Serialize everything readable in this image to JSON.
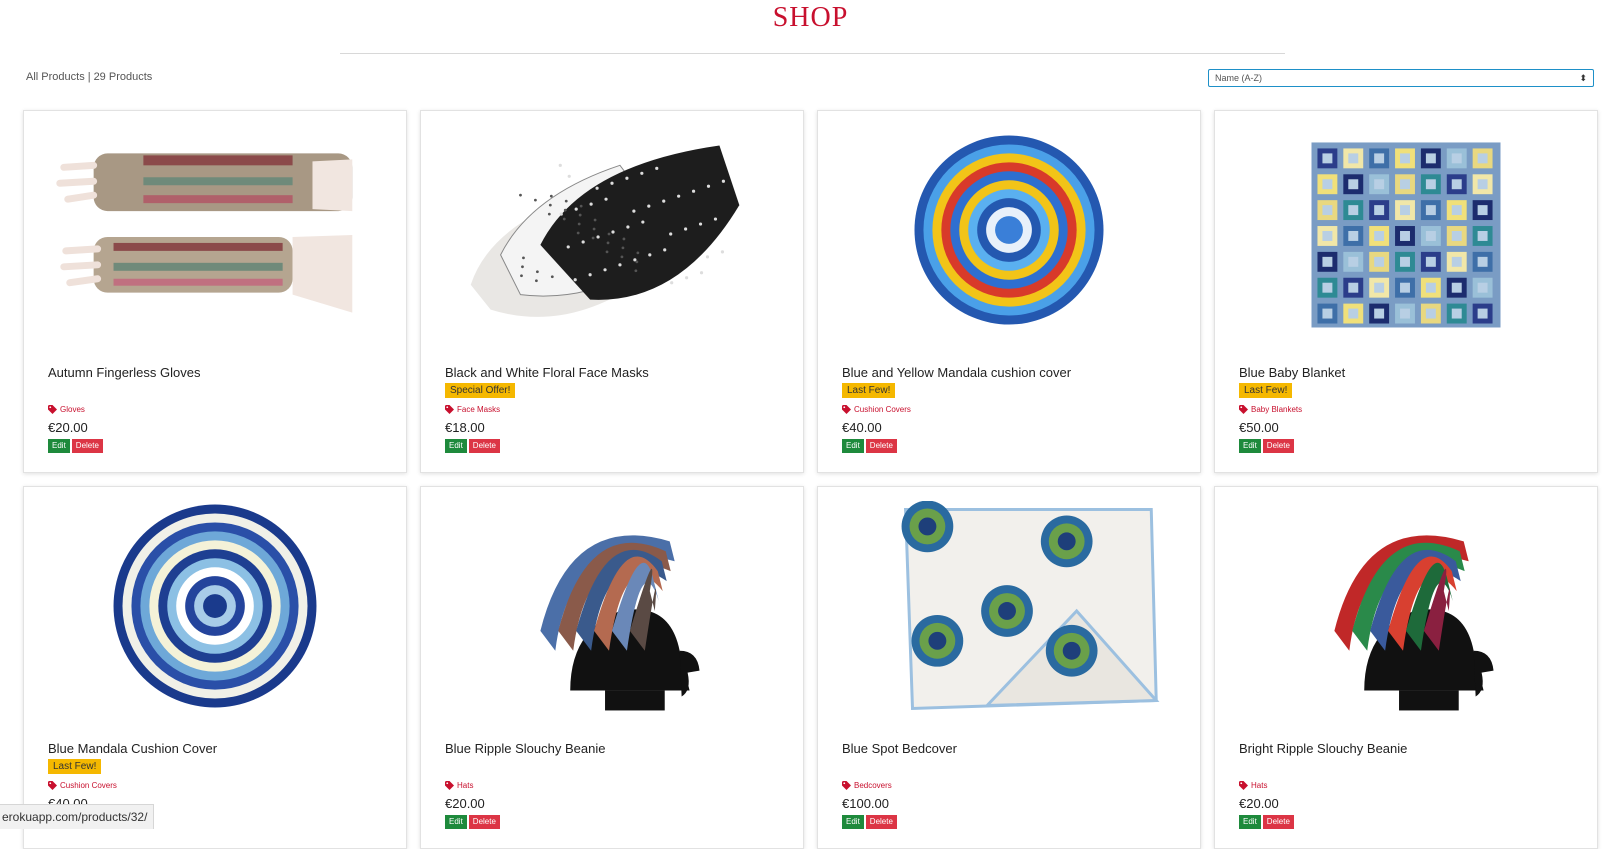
{
  "page": {
    "title": "SHOP"
  },
  "filter": {
    "category": "All Products",
    "count": "29 Products"
  },
  "sort": {
    "selected": "Name (A-Z)"
  },
  "products": [
    {
      "name": "Autumn Fingerless Gloves",
      "badge": "",
      "category": "Gloves",
      "price": "€20.00",
      "edit": "Edit",
      "delete": "Delete",
      "image": "gloves"
    },
    {
      "name": "Black and White Floral Face Masks",
      "badge": "Special Offer!",
      "category": "Face Masks",
      "price": "€18.00",
      "edit": "Edit",
      "delete": "Delete",
      "image": "masks"
    },
    {
      "name": "Blue and Yellow Mandala cushion cover",
      "badge": "Last Few!",
      "category": "Cushion Covers",
      "price": "€40.00",
      "edit": "Edit",
      "delete": "Delete",
      "image": "mandala-bright"
    },
    {
      "name": "Blue Baby Blanket",
      "badge": "Last Few!",
      "category": "Baby Blankets",
      "price": "€50.00",
      "edit": "Edit",
      "delete": "Delete",
      "image": "blanket"
    },
    {
      "name": "Blue Mandala Cushion Cover",
      "badge": "Last Few!",
      "category": "Cushion Covers",
      "price": "€40.00",
      "edit": "Edit",
      "delete": "Delete",
      "image": "mandala-blue"
    },
    {
      "name": "Blue Ripple Slouchy Beanie",
      "badge": "",
      "category": "Hats",
      "price": "€20.00",
      "edit": "Edit",
      "delete": "Delete",
      "image": "beanie-blue"
    },
    {
      "name": "Blue Spot Bedcover",
      "badge": "",
      "category": "Bedcovers",
      "price": "€100.00",
      "edit": "Edit",
      "delete": "Delete",
      "image": "bedcover"
    },
    {
      "name": "Bright Ripple Slouchy Beanie",
      "badge": "",
      "category": "Hats",
      "price": "€20.00",
      "edit": "Edit",
      "delete": "Delete",
      "image": "beanie-bright"
    }
  ],
  "status_bar": {
    "url": "erokuapp.com/products/32/"
  },
  "colors": {
    "brand": "#c8102e",
    "badge": "#f5b800",
    "edit": "#1e8a3c",
    "delete": "#dc3545",
    "select_border": "#1e90c8"
  },
  "icons": {
    "category": "tag-icon",
    "sort": "sort-arrows-icon"
  }
}
